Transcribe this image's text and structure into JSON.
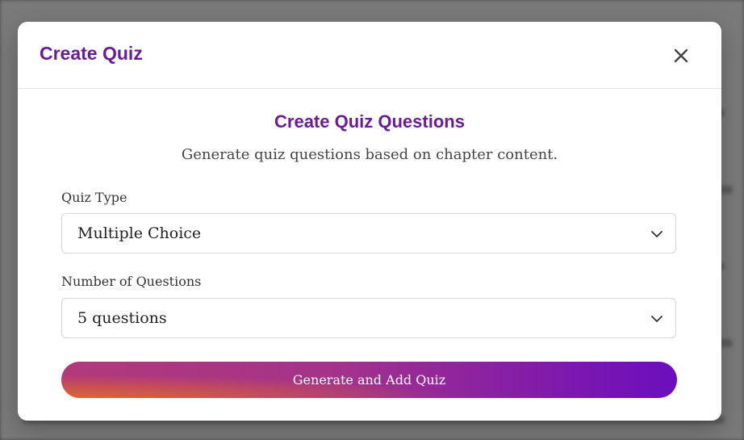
{
  "modal": {
    "title": "Create Quiz",
    "close_icon": "close-icon",
    "section_title": "Create Quiz Questions",
    "section_description": "Generate quiz questions based on chapter content.",
    "quiz_type": {
      "label": "Quiz Type",
      "selected": "Multiple Choice"
    },
    "question_count": {
      "label": "Number of Questions",
      "selected": "5 questions"
    },
    "generate_button": "Generate and Add Quiz"
  },
  "colors": {
    "accent": "#6a1b9a",
    "button_gradient_start": "#e0662f",
    "button_gradient_end": "#6a0fbd"
  }
}
